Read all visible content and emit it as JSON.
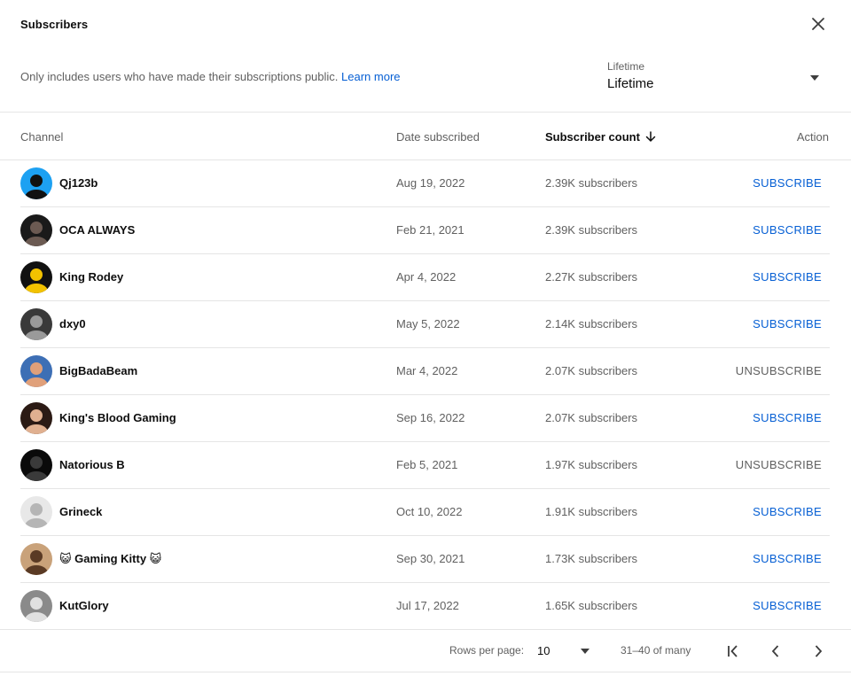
{
  "dialog": {
    "title": "Subscribers",
    "notice": "Only includes users who have made their subscriptions public.",
    "learn_more": "Learn more",
    "period": {
      "label": "Lifetime",
      "value": "Lifetime"
    }
  },
  "table": {
    "columns": {
      "channel": "Channel",
      "date": "Date subscribed",
      "count": "Subscriber count",
      "action": "Action"
    },
    "sort": {
      "column": "Subscriber count",
      "direction": "descending"
    },
    "rows": [
      {
        "name": "Qj123b",
        "date": "Aug 19, 2022",
        "count": "2.39K subscribers",
        "action": "SUBSCRIBE",
        "avatar_colors": [
          "#1da1f2",
          "#111111"
        ]
      },
      {
        "name": "OCA ALWAYS",
        "date": "Feb 21, 2021",
        "count": "2.39K subscribers",
        "action": "SUBSCRIBE",
        "avatar_colors": [
          "#1a1a1a",
          "#6b5a52"
        ]
      },
      {
        "name": "King Rodey",
        "date": "Apr 4, 2022",
        "count": "2.27K subscribers",
        "action": "SUBSCRIBE",
        "avatar_colors": [
          "#111111",
          "#f2c200"
        ]
      },
      {
        "name": "dxy0",
        "date": "May 5, 2022",
        "count": "2.14K subscribers",
        "action": "SUBSCRIBE",
        "avatar_colors": [
          "#3a3a3a",
          "#9a9a9a"
        ]
      },
      {
        "name": "BigBadaBeam",
        "date": "Mar 4, 2022",
        "count": "2.07K subscribers",
        "action": "UNSUBSCRIBE",
        "avatar_colors": [
          "#3d6fb5",
          "#e0a07a"
        ]
      },
      {
        "name": "King's Blood Gaming",
        "date": "Sep 16, 2022",
        "count": "2.07K subscribers",
        "action": "SUBSCRIBE",
        "avatar_colors": [
          "#2b1a14",
          "#e0b090"
        ]
      },
      {
        "name": "Natorious B",
        "date": "Feb 5, 2021",
        "count": "1.97K subscribers",
        "action": "UNSUBSCRIBE",
        "avatar_colors": [
          "#0a0a0a",
          "#3a3a3a"
        ]
      },
      {
        "name": "Grineck",
        "date": "Oct 10, 2022",
        "count": "1.91K subscribers",
        "action": "SUBSCRIBE",
        "avatar_colors": [
          "#e8e8e8",
          "#b5b5b5"
        ]
      },
      {
        "name": "😺 Gaming Kitty 😺",
        "date": "Sep 30, 2021",
        "count": "1.73K subscribers",
        "action": "SUBSCRIBE",
        "avatar_colors": [
          "#c9a27a",
          "#5a3a24"
        ]
      },
      {
        "name": "KutGlory",
        "date": "Jul 17, 2022",
        "count": "1.65K subscribers",
        "action": "SUBSCRIBE",
        "avatar_colors": [
          "#8a8a8a",
          "#e0e0e0"
        ]
      }
    ]
  },
  "pagination": {
    "rows_per_page_label": "Rows per page:",
    "rows_per_page": "10",
    "range": "31–40 of many"
  },
  "colors": {
    "link": "#065fd4",
    "secondary_text": "#606060",
    "divider": "#e5e5e5"
  },
  "icons": {
    "close": "close-icon",
    "dropdown": "caret-down-icon",
    "sort": "arrow-down-icon",
    "first_page": "first-page-icon",
    "prev_page": "chevron-left-icon",
    "next_page": "chevron-right-icon"
  }
}
